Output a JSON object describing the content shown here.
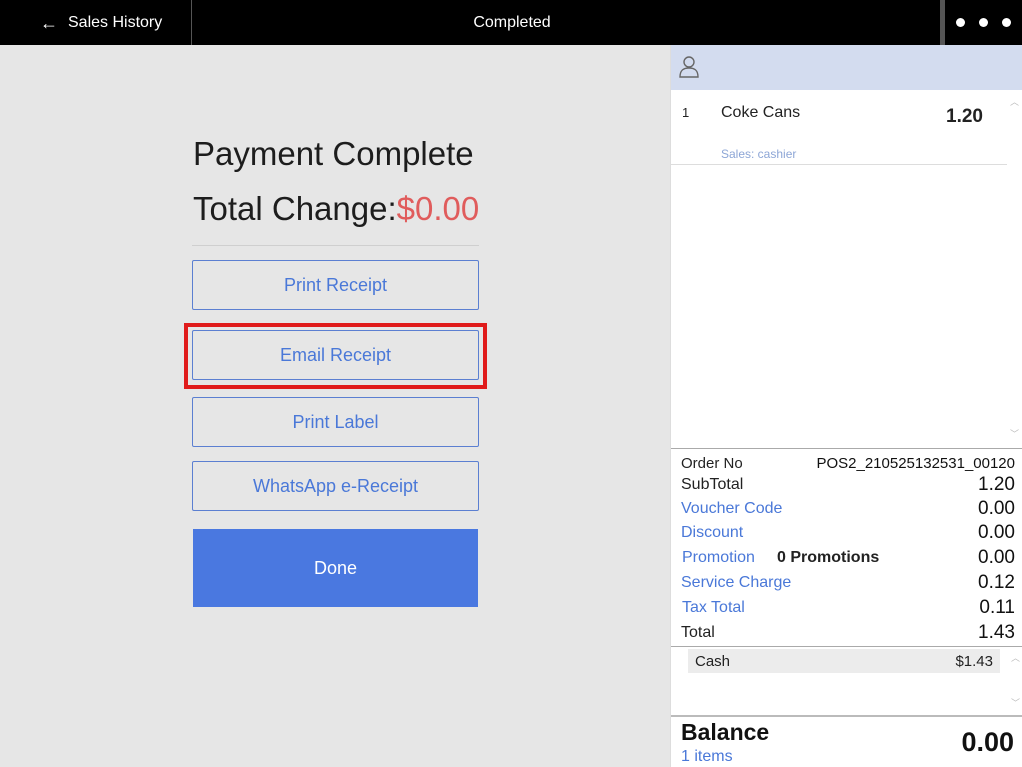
{
  "topbar": {
    "back_label": "Sales History",
    "title": "Completed"
  },
  "payment": {
    "heading": "Payment Complete",
    "change_label": "Total Change:",
    "change_amount": "$0.00",
    "buttons": {
      "print_receipt": "Print Receipt",
      "email_receipt": "Email Receipt",
      "print_label": "Print Label",
      "whatsapp": "WhatsApp e-Receipt",
      "done": "Done"
    }
  },
  "order": {
    "items": [
      {
        "qty": "1",
        "name": "Coke Cans",
        "price": "1.20",
        "sales": "Sales: cashier"
      }
    ],
    "summary": {
      "order_no_label": "Order No",
      "order_no": "POS2_210525132531_00120",
      "subtotal_label": "SubTotal",
      "subtotal": "1.20",
      "voucher_label": "Voucher Code",
      "voucher": "0.00",
      "discount_label": "Discount",
      "discount": "0.00",
      "promotion_label": "Promotion",
      "promotion_count": "0 Promotions",
      "promotion": "0.00",
      "service_label": "Service Charge",
      "service": "0.12",
      "tax_label": "Tax Total",
      "tax": "0.11",
      "total_label": "Total",
      "total": "1.43"
    },
    "payments": [
      {
        "method": "Cash",
        "amount": "$1.43"
      }
    ],
    "balance_label": "Balance",
    "items_count": "1 items",
    "balance": "0.00"
  },
  "colors": {
    "accent": "#4a78e0",
    "highlight": "#e01b1b",
    "change_red": "#e05c5c",
    "customer_bar": "#d3dcef"
  },
  "icons": {
    "back": "arrow-left-icon",
    "menu": "more-dots-icon",
    "customer": "user-icon"
  }
}
